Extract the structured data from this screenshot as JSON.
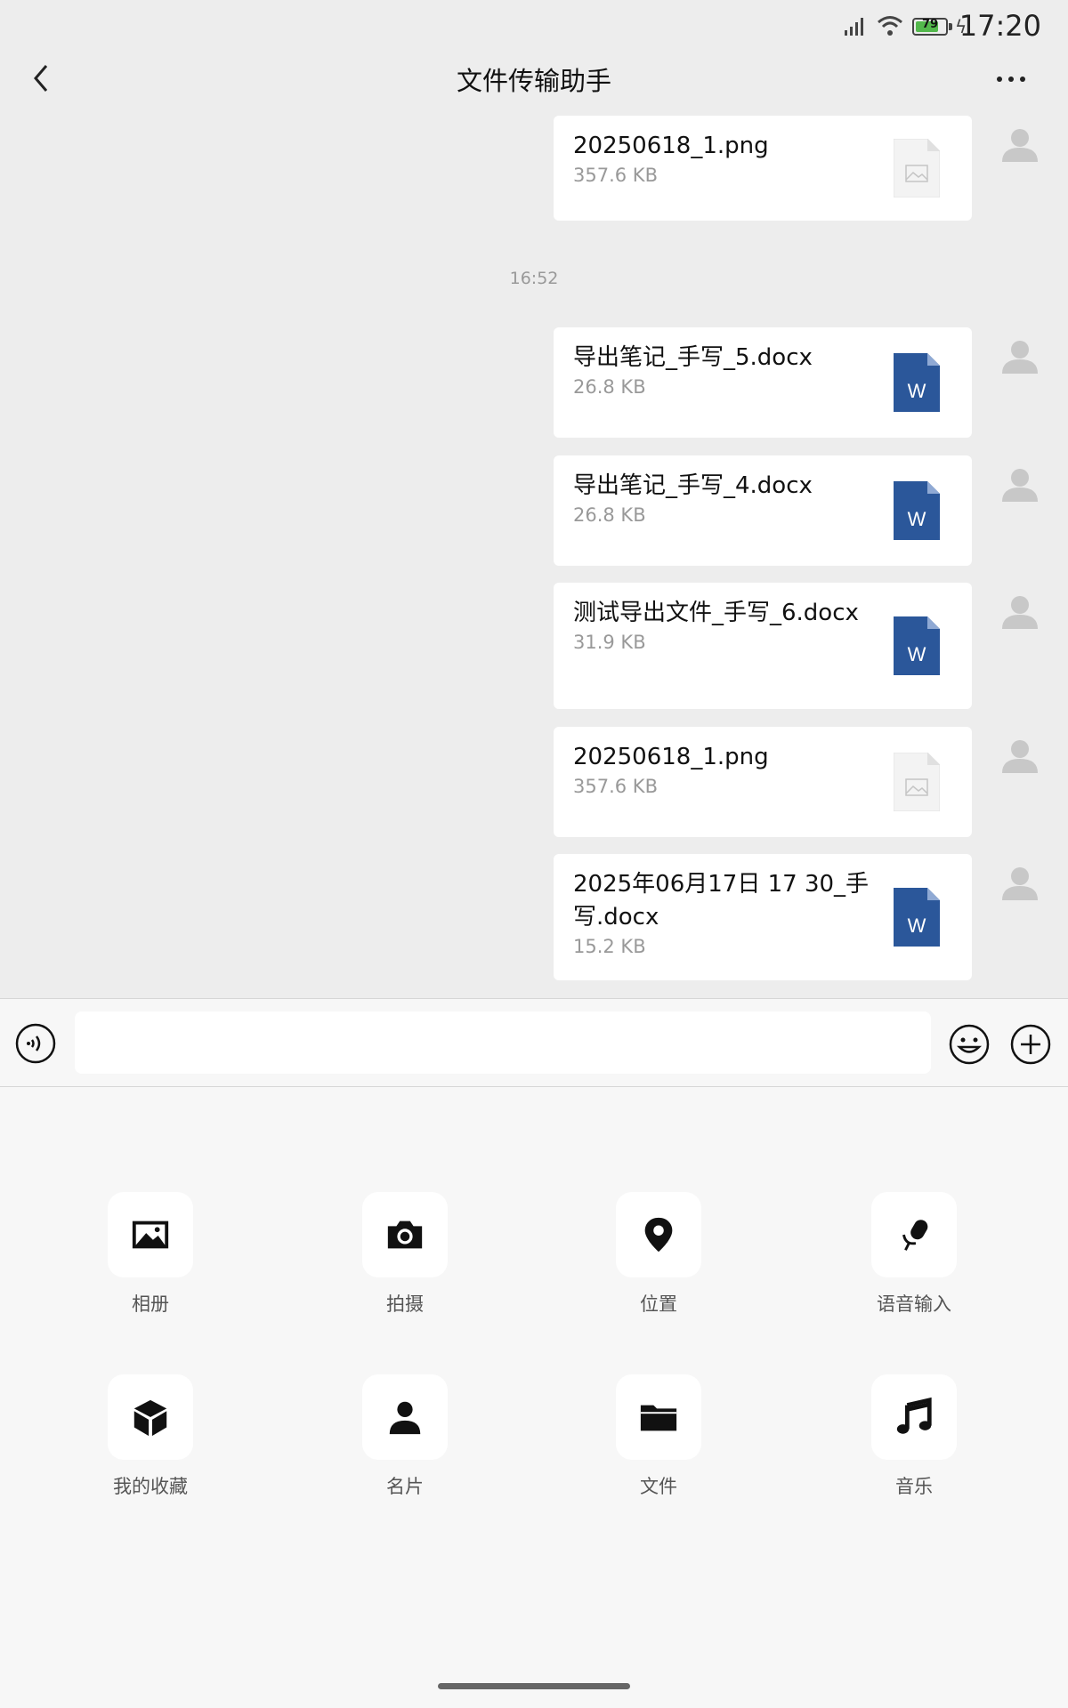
{
  "status_bar": {
    "time": "17:20",
    "battery_level": "79"
  },
  "header": {
    "title": "文件传输助手"
  },
  "messages": [
    {
      "name": "20250618_1.png",
      "size": "357.6 KB",
      "icon": "image-file-icon"
    },
    {
      "name": "导出笔记_手写_5.docx",
      "size": "26.8 KB",
      "icon": "word-doc-icon"
    },
    {
      "name": "导出笔记_手写_4.docx",
      "size": "26.8 KB",
      "icon": "word-doc-icon"
    },
    {
      "name": "测试导出文件_手写_6.docx",
      "size": "31.9 KB",
      "icon": "word-doc-icon"
    },
    {
      "name": "20250618_1.png",
      "size": "357.6 KB",
      "icon": "image-file-icon"
    },
    {
      "name": "2025年06月17日 17 30_手写.docx",
      "size": "15.2 KB",
      "icon": "word-doc-icon"
    }
  ],
  "time_separator": "16:52",
  "input": {
    "value": "",
    "placeholder": ""
  },
  "tools": [
    {
      "label": "相册",
      "icon": "photo-album-icon"
    },
    {
      "label": "拍摄",
      "icon": "camera-icon"
    },
    {
      "label": "位置",
      "icon": "location-pin-icon"
    },
    {
      "label": "语音输入",
      "icon": "microphone-icon"
    },
    {
      "label": "我的收藏",
      "icon": "favorites-cube-icon"
    },
    {
      "label": "名片",
      "icon": "contact-card-icon"
    },
    {
      "label": "文件",
      "icon": "folder-icon"
    },
    {
      "label": "音乐",
      "icon": "music-note-icon"
    }
  ],
  "colors": {
    "word_blue": "#2b579a",
    "chat_bg": "#ededed",
    "panel_bg": "#f7f7f7"
  }
}
